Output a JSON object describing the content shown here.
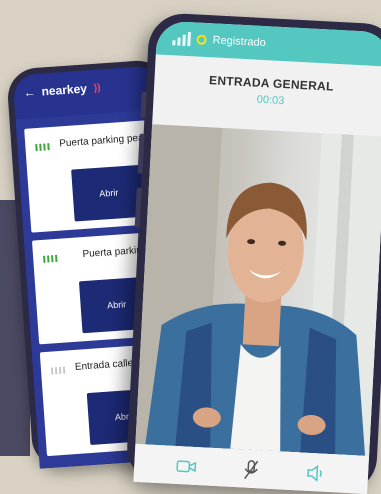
{
  "back_app": {
    "brand": "nearkey",
    "doors": [
      {
        "label": "Puerta parking peatonal",
        "button": "Abrir",
        "signal": "green"
      },
      {
        "label": "Puerta parking",
        "button": "Abrir",
        "signal": "green"
      },
      {
        "label": "Entrada calle peatonal",
        "button": "Abrir",
        "signal": "grey"
      }
    ]
  },
  "front_app": {
    "status": "Registrado",
    "call_title": "ENTRADA GENERAL",
    "timer": "00:03",
    "controls": [
      "video-icon",
      "mic-off-icon",
      "speaker-icon"
    ]
  },
  "colors": {
    "accent_teal": "#55c7c1",
    "brand_blue": "#27338f",
    "button_navy": "#1d2a75",
    "status_yellow": "#f7e21a"
  }
}
